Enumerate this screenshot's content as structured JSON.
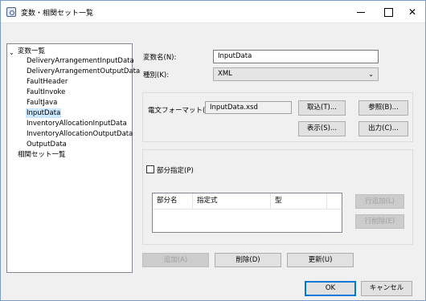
{
  "window": {
    "title": "変数・相関セット一覧"
  },
  "tree": {
    "root_label": "変数一覧",
    "items": [
      {
        "label": "DeliveryArrangementInputData"
      },
      {
        "label": "DeliveryArrangementOutputData"
      },
      {
        "label": "FaultHeader"
      },
      {
        "label": "FaultInvoke"
      },
      {
        "label": "FaultJava"
      },
      {
        "label": "InputData",
        "selected": true
      },
      {
        "label": "InventoryAllocationInputData"
      },
      {
        "label": "InventoryAllocationOutputData"
      },
      {
        "label": "OutputData"
      }
    ],
    "second_root_label": "相関セット一覧"
  },
  "form": {
    "var_name_label": "変数名(N):",
    "var_name_value": "InputData",
    "type_label": "種別(K):",
    "type_value": "XML",
    "format_label": "電文フォーマット(F):",
    "format_value": "InputData.xsd",
    "import_btn": "取込(T)...",
    "ref_btn": "参照(B)...",
    "show_btn": "表示(S)...",
    "output_btn": "出力(C)...",
    "partial_label": "部分指定(P)",
    "partial_checked": false,
    "table_columns": [
      "部分名",
      "指定式",
      "型"
    ],
    "add_row_btn": "行追加(L)",
    "del_row_btn": "行削除(E)"
  },
  "actions": {
    "add_btn": "追加(A)",
    "delete_btn": "削除(D)",
    "update_btn": "更新(U)",
    "ok_btn": "OK",
    "cancel_btn": "キャンセル"
  }
}
